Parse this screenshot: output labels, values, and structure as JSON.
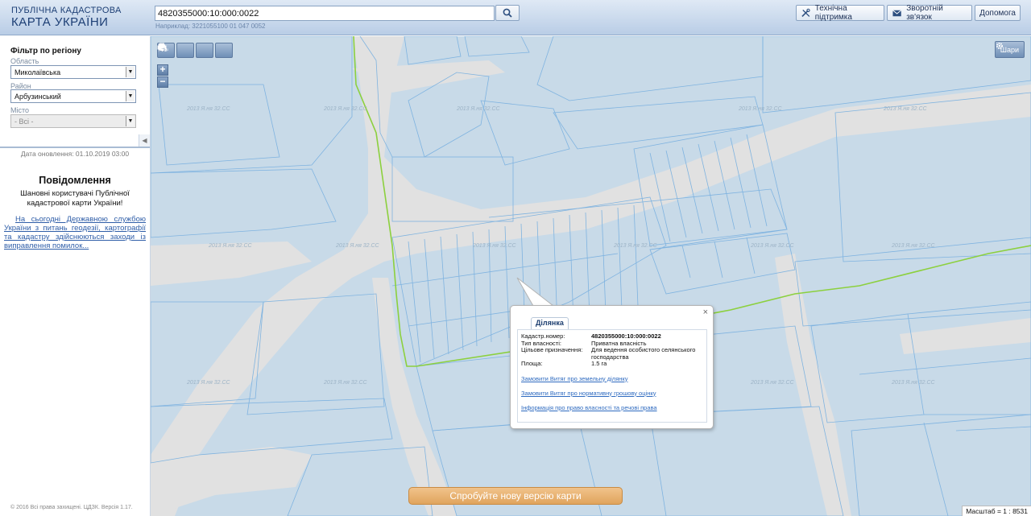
{
  "header": {
    "logo_line1": "ПУБЛІЧНА КАДАСТРОВА",
    "logo_line2": "КАРТА УКРАЇНИ",
    "search_value": "4820355000:10:000:0022",
    "example_text": "Наприклад: 3221055100 01 047 0052",
    "buttons": {
      "support": "Технічна підтримка",
      "feedback": "Зворотній зв'язок",
      "help": "Допомога"
    }
  },
  "sidebar": {
    "filter_title": "Фільтр по регіону",
    "region_label": "Область",
    "region_value": "Миколаївська",
    "district_label": "Район",
    "district_value": "Арбузинський",
    "city_label": "Місто",
    "city_value": "- Всі -",
    "update_date": "Дата оновлення: 01.10.2019 03:00",
    "notice_title": "Повідомлення",
    "notice_subtitle": "Шановні користувачі Публічної кадастрової карти України!",
    "notice_link": "На сьогодні Державною службою України з питань геодезії, картографії та кадастру здійснюються заходи із виправлення помилок...",
    "copyright": "© 2016 Всі права захищені. ЦДЗК. Версія 1.17."
  },
  "map": {
    "layers_label": "Шари",
    "watermark": "2013 Я.ня 32.СС",
    "popup": {
      "tab": "Ділянка",
      "close": "×",
      "fields": [
        {
          "label": "Кадастр.номер:",
          "value": "4820355000:10:000:0022"
        },
        {
          "label": "Тип власності:",
          "value": "Приватна власність"
        },
        {
          "label": "Цільове призначення:",
          "value": "Для ведення особистого селянського господарства"
        },
        {
          "label": "Площа:",
          "value": "1.5 га"
        }
      ],
      "links": [
        "Замовити Витяг про земельну ділянку",
        "Замовити Витяг про нормативну грошову оцінку",
        "Інформація про право власності та речові права"
      ]
    },
    "try_new": "Спробуйте нову версію карти",
    "scale_text": "Масштаб = 1 : 8531"
  }
}
